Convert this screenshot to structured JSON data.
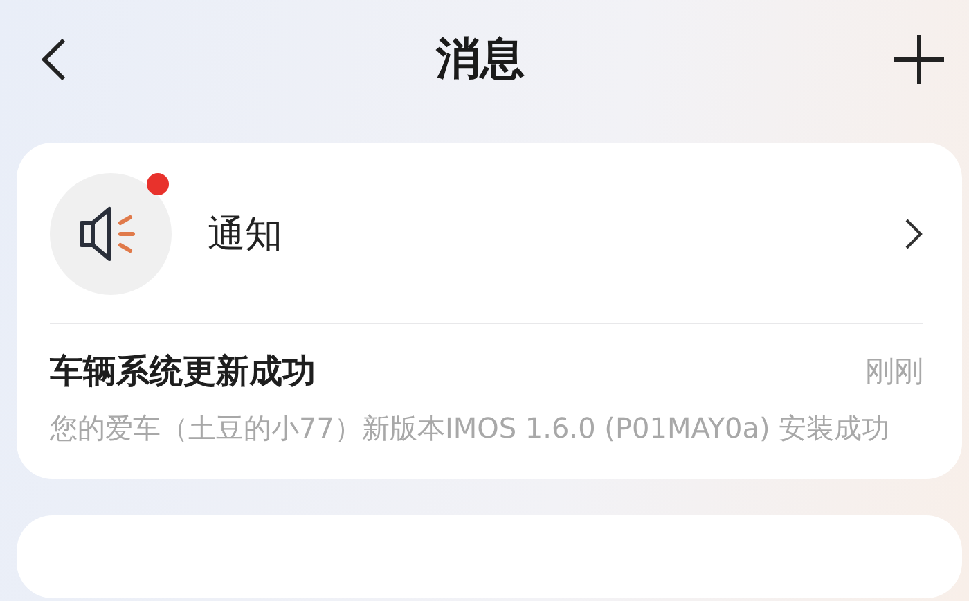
{
  "header": {
    "title": "消息"
  },
  "notification_card": {
    "label": "通知",
    "unread": true,
    "message": {
      "title": "车辆系统更新成功",
      "time": "刚刚",
      "body": "您的爱车（土豆的小77）新版本IMOS 1.6.0 (P01MAY0a) 安装成功"
    }
  }
}
